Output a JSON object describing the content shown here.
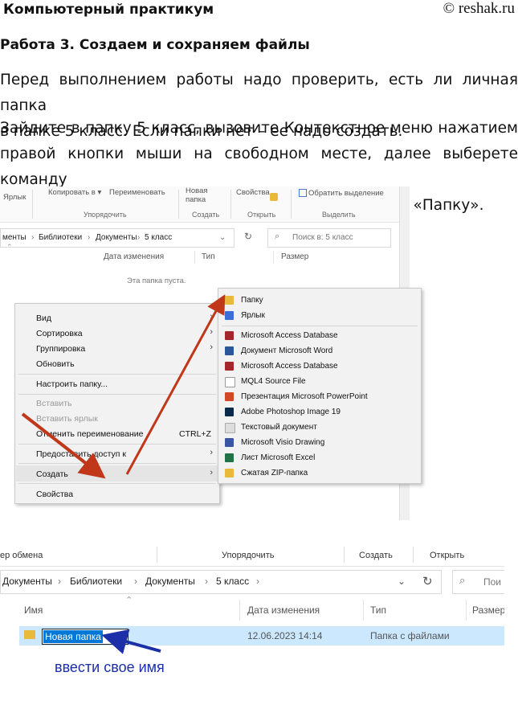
{
  "header": {
    "left": "Компьютерный практикум",
    "right": "© reshak.ru"
  },
  "title": "Работа 3. Создаем и сохраняем файлы",
  "para1": [
    "Перед выполнением работы надо проверить, есть ли личная папка",
    "в папке 5 класс. Если папки нет – ее надо создать."
  ],
  "para2": [
    "Зайдите в папку 5 класс, вызовите Контекстное меню нажатием",
    "правой кнопки мыши на свободном месте, далее выберете команду",
    "«Создать», в появившемся боковом меню выберете «Папку»."
  ],
  "shot1": {
    "ribbon": {
      "btns": [
        "Ярлык",
        "Копировать в ▾",
        "Переименовать",
        "Новая",
        "папка",
        "Свойства",
        "Обратить выделение"
      ],
      "groups": [
        "Упорядочить",
        "Создать",
        "Открыть",
        "Выделить"
      ]
    },
    "crumbs": [
      "менты",
      "Библиотеки",
      "Документы",
      "5 класс"
    ],
    "search": "Поиск в: 5 класс",
    "cols": [
      "Дата изменения",
      "Тип",
      "Размер"
    ],
    "empty": "Эта папка пуста.",
    "context": {
      "view": "Вид",
      "sort": "Сортировка",
      "group": "Группировка",
      "refresh": "Обновить",
      "customize": "Настроить папку...",
      "paste": "Вставить",
      "paste_link": "Вставить ярлык",
      "undo": "Отменить переименование",
      "undo_key": "CTRL+Z",
      "share": "Предоставить доступ к",
      "create": "Создать",
      "props": "Свойства"
    },
    "submenu": [
      {
        "label": "Папку",
        "color": "#e8b93a"
      },
      {
        "label": "Ярлык",
        "color": "#3a6fd8"
      },
      {
        "label": "Microsoft Access Database",
        "color": "#a4262c"
      },
      {
        "label": "Документ Microsoft Word",
        "color": "#2b579a"
      },
      {
        "label": "Microsoft Access Database",
        "color": "#a4262c"
      },
      {
        "label": "MQL4 Source File",
        "color": "#ffffff"
      },
      {
        "label": "Презентация Microsoft PowerPoint",
        "color": "#d24726"
      },
      {
        "label": "Adobe Photoshop Image 19",
        "color": "#0b2a4a"
      },
      {
        "label": "Текстовый документ",
        "color": "#dddddd"
      },
      {
        "label": "Microsoft Visio Drawing",
        "color": "#3955a3"
      },
      {
        "label": "Лист Microsoft Excel",
        "color": "#217346"
      },
      {
        "label": "Сжатая ZIP-папка",
        "color": "#e8b93a"
      }
    ]
  },
  "shot2": {
    "groups": [
      "ер обмена",
      "Упорядочить",
      "Создать",
      "Открыть"
    ],
    "crumbs": [
      "Документы",
      "Библиотеки",
      "Документы",
      "5 класс"
    ],
    "search": "Пои",
    "cols": [
      "Имя",
      "Дата изменения",
      "Тип",
      "Размер"
    ],
    "row": {
      "name": "Новая папка",
      "date": "12.06.2023 14:14",
      "type": "Папка с файлами"
    },
    "note": "ввести свое имя"
  },
  "colors": {
    "arrow_red": "#c0371a",
    "arrow_blue": "#1b2fa8",
    "selection": "#cce8ff"
  }
}
